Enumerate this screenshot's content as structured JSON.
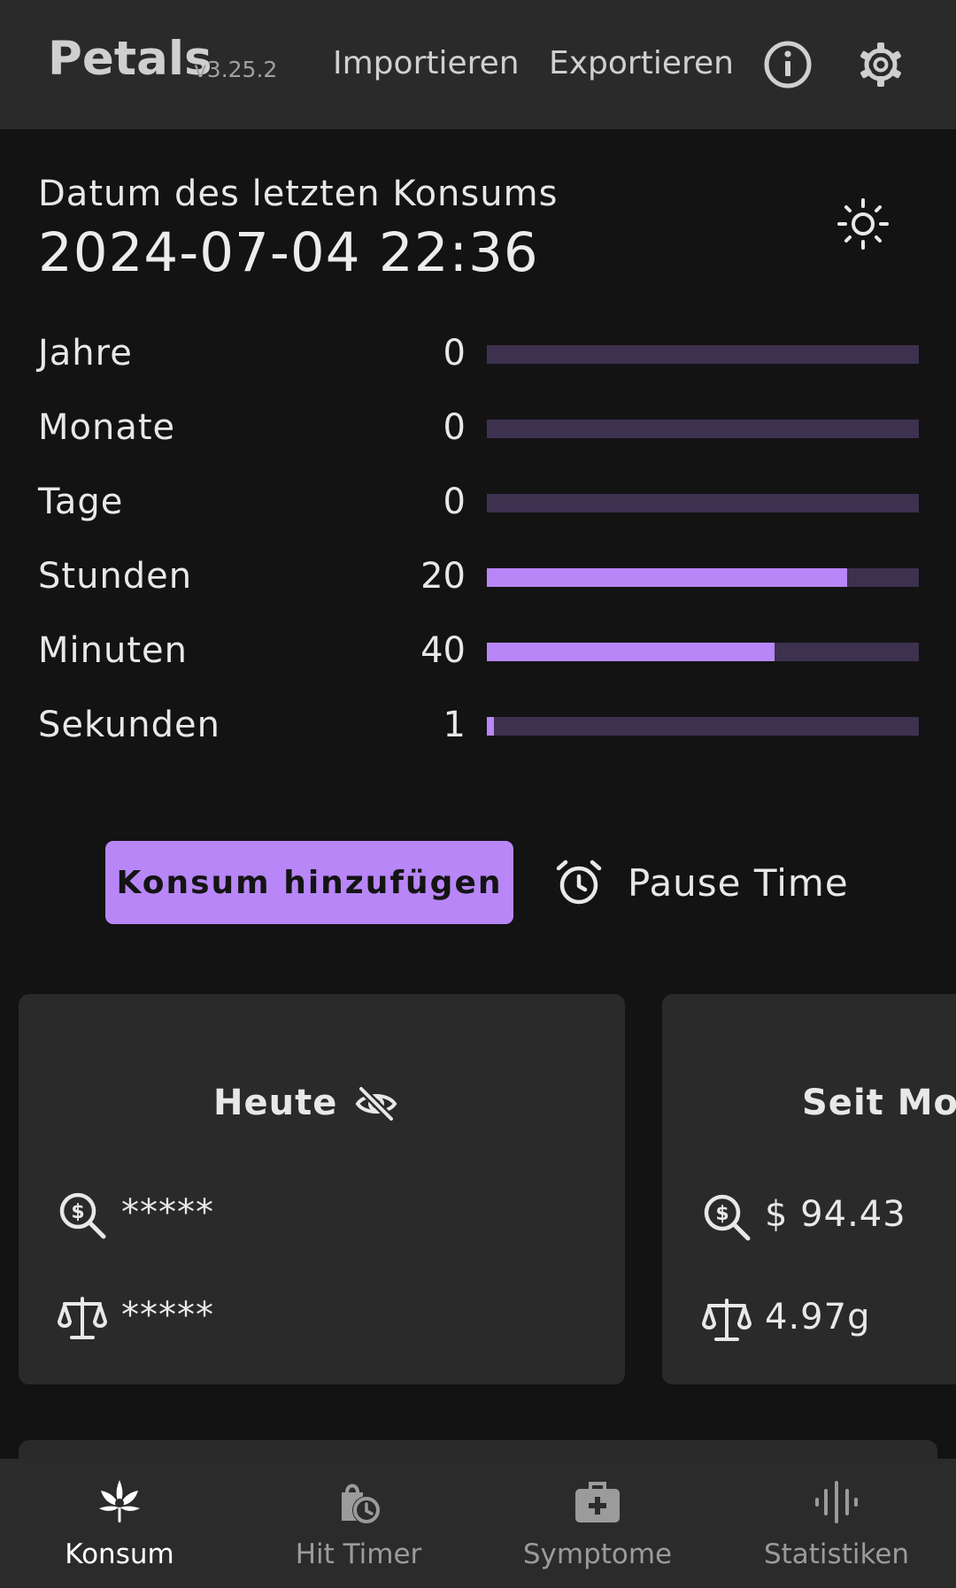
{
  "header": {
    "title": "Petals",
    "version": "v3.25.2",
    "import_label": "Importieren",
    "export_label": "Exportieren",
    "info_icon": "info-icon",
    "settings_icon": "gear-icon"
  },
  "last_use": {
    "label": "Datum des letzten Konsums",
    "date": "2024-07-04 22:36",
    "theme_icon": "sun-icon"
  },
  "timer_rows": [
    {
      "label": "Jahre",
      "value": "0",
      "fraction": 0
    },
    {
      "label": "Monate",
      "value": "0",
      "fraction": 0
    },
    {
      "label": "Tage",
      "value": "0",
      "fraction": 0
    },
    {
      "label": "Stunden",
      "value": "20",
      "fraction": 0.833
    },
    {
      "label": "Minuten",
      "value": "40",
      "fraction": 0.667
    },
    {
      "label": "Sekunden",
      "value": "1",
      "fraction": 0.017
    }
  ],
  "actions": {
    "add_label": "Konsum hinzufügen",
    "pause_label": "Pause Time",
    "pause_icon": "alarm-clock-icon"
  },
  "cards": [
    {
      "title": "Heute",
      "cost": "*****",
      "weight": "*****",
      "hidden_icon": "eye-off-icon"
    },
    {
      "title": "Seit Mon",
      "cost": "$ 94.43",
      "weight": "4.97g"
    }
  ],
  "nav": {
    "items": [
      {
        "label": "Konsum",
        "icon": "cannabis-leaf-icon",
        "active": true
      },
      {
        "label": "Hit Timer",
        "icon": "timer-bag-icon",
        "active": false
      },
      {
        "label": "Symptome",
        "icon": "medical-kit-icon",
        "active": false
      },
      {
        "label": "Statistiken",
        "icon": "audio-bars-icon",
        "active": false
      }
    ]
  },
  "colors": {
    "accent": "#b886f7",
    "track": "#3d3150",
    "background": "#131313",
    "surface": "#2a2a2a"
  }
}
